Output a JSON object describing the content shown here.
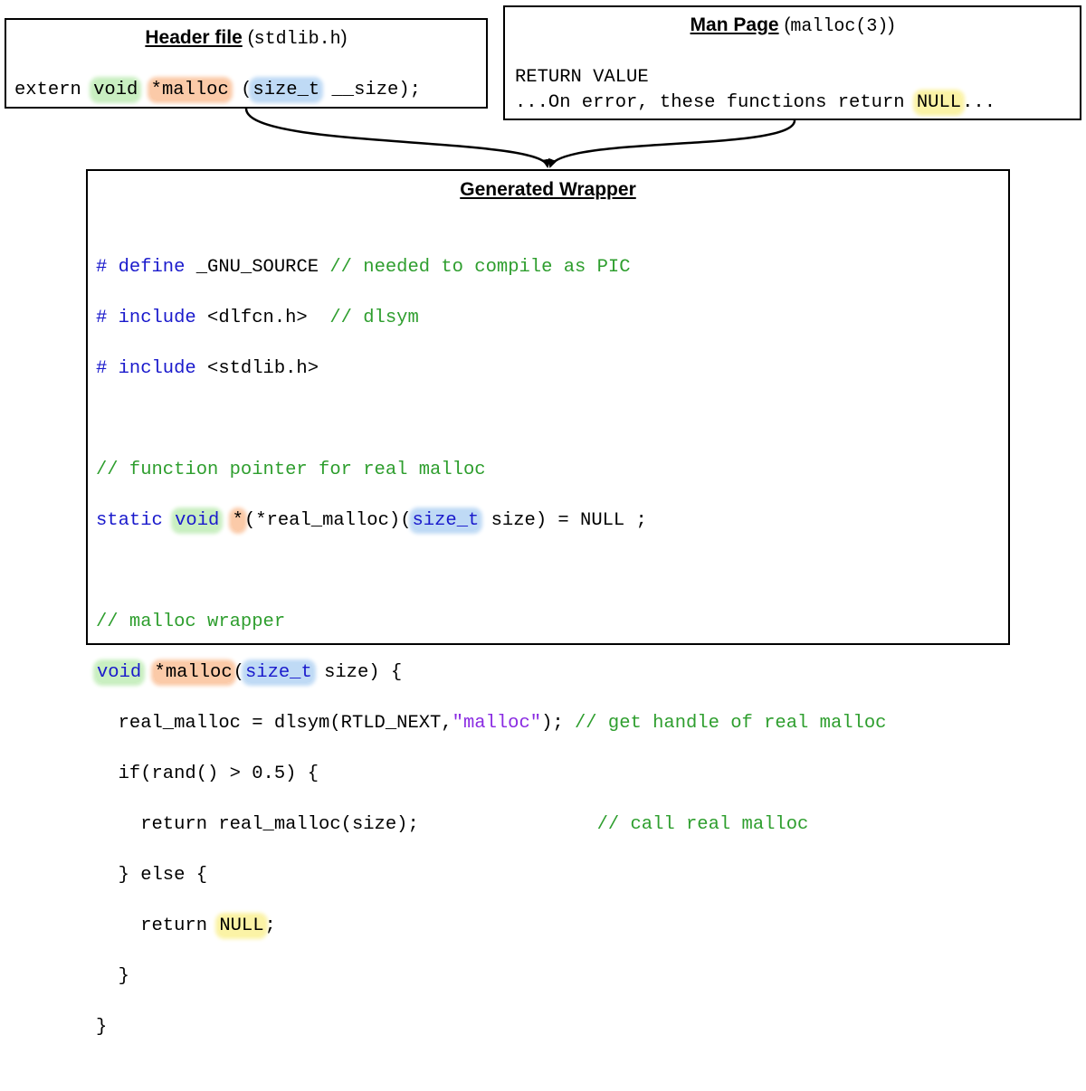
{
  "header_box": {
    "title_bold": "Header file",
    "title_paren_open": " (",
    "title_mono": "stdlib.h",
    "title_paren_close": ")",
    "line": {
      "t1": "extern ",
      "void": "void",
      "t2": " ",
      "malloc": "*malloc",
      "t3": " (",
      "size_t": "size_t",
      "t4": " __size);"
    }
  },
  "man_box": {
    "title_bold": "Man Page",
    "title_paren_open": " (",
    "title_mono": "malloc(3)",
    "title_paren_close": ")",
    "line1": "RETURN VALUE",
    "line2": {
      "t1": "...On error, these functions return ",
      "null": "NULL",
      "t2": "..."
    }
  },
  "wrapper_box": {
    "title": "Generated Wrapper",
    "l1": {
      "kw": "# define",
      "t": " _GNU_SOURCE ",
      "cm": "// needed to compile as PIC"
    },
    "l2": {
      "kw": "# include",
      "t": " <dlfcn.h>  ",
      "cm": "// dlsym"
    },
    "l3": {
      "kw": "# include",
      "t": " <stdlib.h>"
    },
    "l4": {
      "cm": "// function pointer for real malloc"
    },
    "l5": {
      "kw": "static",
      "t1": " ",
      "void": "void",
      "t2": " ",
      "star": "*",
      "t3": "(*real_malloc)(",
      "size_t": "size_t",
      "t4": " size) = NULL ;"
    },
    "l6": {
      "cm": "// malloc wrapper"
    },
    "l7": {
      "void": "void",
      "t1": " ",
      "malloc": "*malloc",
      "t2": "(",
      "size_t": "size_t",
      "t3": " size) {"
    },
    "l8": {
      "t1": "  real_malloc = dlsym(RTLD_NEXT,",
      "str": "\"malloc\"",
      "t2": "); ",
      "cm": "// get handle of real malloc"
    },
    "l9": {
      "t": "  if(rand() > 0.5) {"
    },
    "l10": {
      "t": "    return real_malloc(size);                ",
      "cm": "// call real malloc"
    },
    "l11": {
      "t": "  } else {"
    },
    "l12": {
      "t1": "    return ",
      "null": "NULL",
      "t2": ";"
    },
    "l13": {
      "t": "  }"
    },
    "l14": {
      "t": "}"
    }
  }
}
